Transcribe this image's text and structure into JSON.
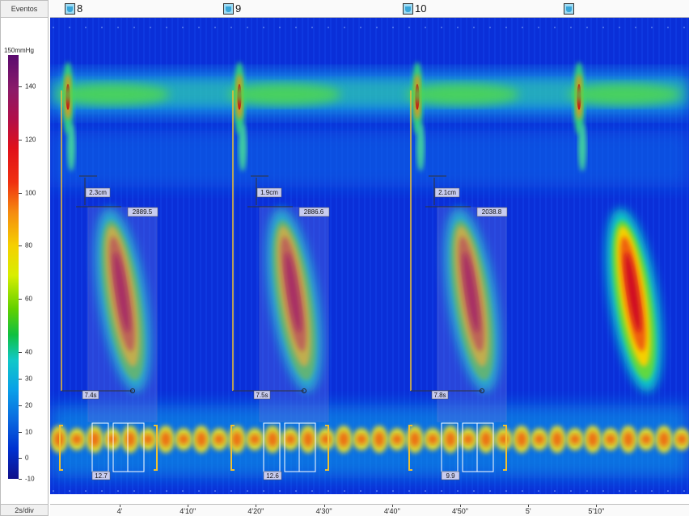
{
  "header": {
    "events_label": "Eventos"
  },
  "events": [
    {
      "label": "8",
      "icon": "swallow-cup-icon"
    },
    {
      "label": "9",
      "icon": "swallow-cup-icon"
    },
    {
      "label": "10",
      "icon": "swallow-cup-icon"
    },
    {
      "label": "",
      "icon": "swallow-cup-icon"
    }
  ],
  "scale": {
    "unit_label": "150mmHg",
    "ticks": [
      "140",
      "120",
      "100",
      "80",
      "60",
      "40",
      "30",
      "20",
      "10",
      "0",
      "-10"
    ]
  },
  "footer": {
    "speed_label": "2s/div"
  },
  "time_axis": {
    "ticks": [
      "4'",
      "4'10\"",
      "4'20\"",
      "4'30\"",
      "4'40\"",
      "4'50\"",
      "5'",
      "5'10\""
    ]
  },
  "chart_data": {
    "type": "heatmap",
    "title": "",
    "xlabel": "",
    "ylabel": "",
    "color_scale": {
      "min": -10,
      "max": 150,
      "unit": "mmHg"
    },
    "x_ticks_seconds": [
      240,
      250,
      260,
      270,
      280,
      290,
      300,
      310
    ],
    "swallows": [
      {
        "event": "8",
        "ues_to_les_distance": "2.3cm",
        "dci": "2889.5",
        "distal_latency": "7.4s",
        "irp": "12.7"
      },
      {
        "event": "9",
        "ues_to_les_distance": "1.9cm",
        "dci": "2886.6",
        "distal_latency": "7.5s",
        "irp": "12.6"
      },
      {
        "event": "10",
        "ues_to_les_distance": "2.1cm",
        "dci": "2038.8",
        "distal_latency": "7.8s",
        "irp": "9.9"
      },
      {
        "event": "",
        "ues_to_les_distance": "",
        "dci": "",
        "distal_latency": "",
        "irp": ""
      }
    ]
  }
}
